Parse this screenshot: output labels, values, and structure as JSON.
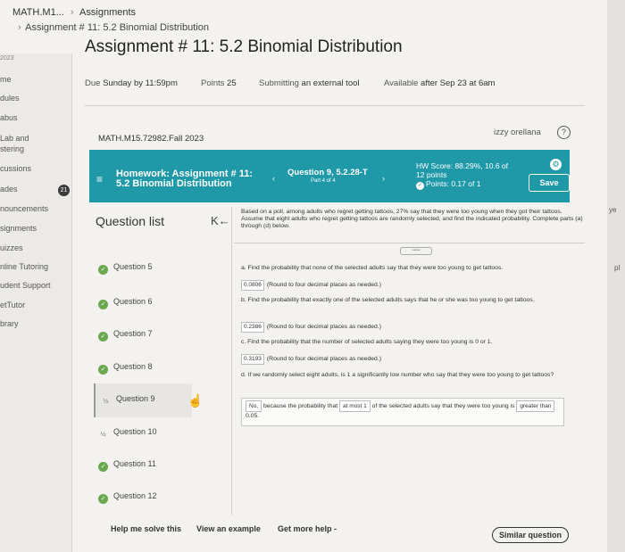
{
  "breadcrumb": {
    "course": "MATH.M1...",
    "sep": "›",
    "section": "Assignments"
  },
  "breadcrumb2": {
    "sep": "›",
    "current": "Assignment # 11: 5.2 Binomial Distribution"
  },
  "page_title": "Assignment # 11: 5.2 Binomial Distribution",
  "leftnav": {
    "items": [
      "2023",
      "me",
      "dules",
      "abus",
      "Lab and",
      "stering",
      "cussions",
      "ades",
      "nouncements",
      "signments",
      "uizzes",
      "nline Tutoring",
      "udent Support",
      "etTutor",
      "brary"
    ],
    "badge": "21"
  },
  "info": {
    "due_label": "Due",
    "due_value": "Sunday by 11:59pm",
    "points_label": "Points",
    "points_value": "25",
    "submitting_label": "Submitting",
    "submitting_value": "an external tool",
    "available_label": "Available",
    "available_value": "after Sep 23 at 6am"
  },
  "course_code": "MATH.M15.72982.Fall 2023",
  "user_name": "izzy orellana",
  "help_icon": "?",
  "topbar": {
    "menu_icon": "≡",
    "hw_line1": "Homework: Assignment # 11:",
    "hw_line2": "5.2 Binomial Distribution",
    "prev_icon": "‹",
    "question": "Question 9, 5.2.28-T",
    "part": "Part 4 of 4",
    "next_icon": "›",
    "score": "HW Score: 88.29%, 10.6 of",
    "score2": "12 points",
    "points": "Points: 0.17 of 1",
    "gear_icon": "⚙",
    "save": "Save"
  },
  "question_list_title": "Question list",
  "collapse_icon": "K←",
  "problem_text": "Based on a poll, among adults who regret getting tattoos, 27% say that they were too young when they got their tattoos. Assume that eight adults who regret getting tattoos are randomly selected, and find the indicated probability. Complete parts (a) through (d) below.",
  "dots": "•••••",
  "questions": [
    {
      "label": "Question 5",
      "status": "done",
      "icon": "✓"
    },
    {
      "label": "Question 6",
      "status": "done",
      "icon": "✓"
    },
    {
      "label": "Question 7",
      "status": "done",
      "icon": "✓"
    },
    {
      "label": "Question 8",
      "status": "done",
      "icon": "✓"
    },
    {
      "label": "Question 9",
      "status": "partial",
      "icon": "½"
    },
    {
      "label": "Question 10",
      "status": "partial",
      "icon": "½"
    },
    {
      "label": "Question 11",
      "status": "done",
      "icon": "✓"
    },
    {
      "label": "Question 12",
      "status": "done",
      "icon": "✓"
    }
  ],
  "pointer_icon": "☝",
  "parts": {
    "a_text": "a. Find the probability that none of the selected adults say that they were too young to get tattoos.",
    "a_answer": "0.0806",
    "a_hint": "(Round to four decimal places as needed.)",
    "b_text": "b. Find the probability that exactly one of the selected adults says that he or she was too young to get tattoos.",
    "b_answer": "0.2386",
    "b_hint": "(Round to four decimal places as needed.)",
    "c_text": "c. Find the probability that the number of selected adults saying they were too young is 0 or 1.",
    "c_answer": "0.3193",
    "c_hint": "(Round to four decimal places as needed.)",
    "d_text": "d. If we randomly select eight adults, is 1 a significantly low number who say that they were too young to get tattoos?",
    "d_ans1": "No,",
    "d_mid": "because the probability that",
    "d_ans2": "at most 1",
    "d_rest": "of the selected adults say that they were too young is",
    "d_ans3": "greater than",
    "d_end": "0.05."
  },
  "bottom": {
    "help": "Help me solve this",
    "example": "View an example",
    "more": "Get more help -",
    "similar": "Similar question"
  },
  "right_edge": {
    "e1": "pl",
    "e2": "ye"
  }
}
